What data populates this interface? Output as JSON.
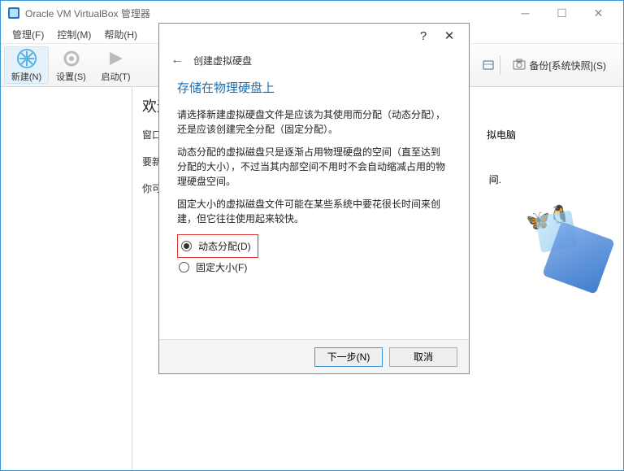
{
  "window": {
    "title": "Oracle VM VirtualBox 管理器"
  },
  "menu": {
    "manage": "管理(F)",
    "control": "控制(M)",
    "help": "帮助(H)"
  },
  "toolbar": {
    "new": "新建(N)",
    "settings": "设置(S)",
    "start": "启动(T)"
  },
  "right_tools": {
    "snapshot": "备份[系统快照](S)"
  },
  "main": {
    "welcome": "欢迎",
    "p1": "窗口",
    "p2": "要新",
    "p3": "你可",
    "decorative_end": "拟电脑",
    "decorative_end2": "间."
  },
  "dialog": {
    "caption": "创建虚拟硬盘",
    "title": "存储在物理硬盘上",
    "intro": "请选择新建虚拟硬盘文件是应该为其使用而分配（动态分配），还是应该创建完全分配（固定分配）。",
    "dynamic_para": "动态分配的虚拟磁盘只是逐渐占用物理硬盘的空间（直至达到 分配的大小），不过当其内部空间不用时不会自动缩减占用的物理硬盘空间。",
    "fixed_para": "固定大小的虚拟磁盘文件可能在某些系统中要花很长时间来创建，但它往往使用起来较快。",
    "radio_dynamic": "动态分配(D)",
    "radio_fixed": "固定大小(F)",
    "next": "下一步(N)",
    "cancel": "取消"
  }
}
